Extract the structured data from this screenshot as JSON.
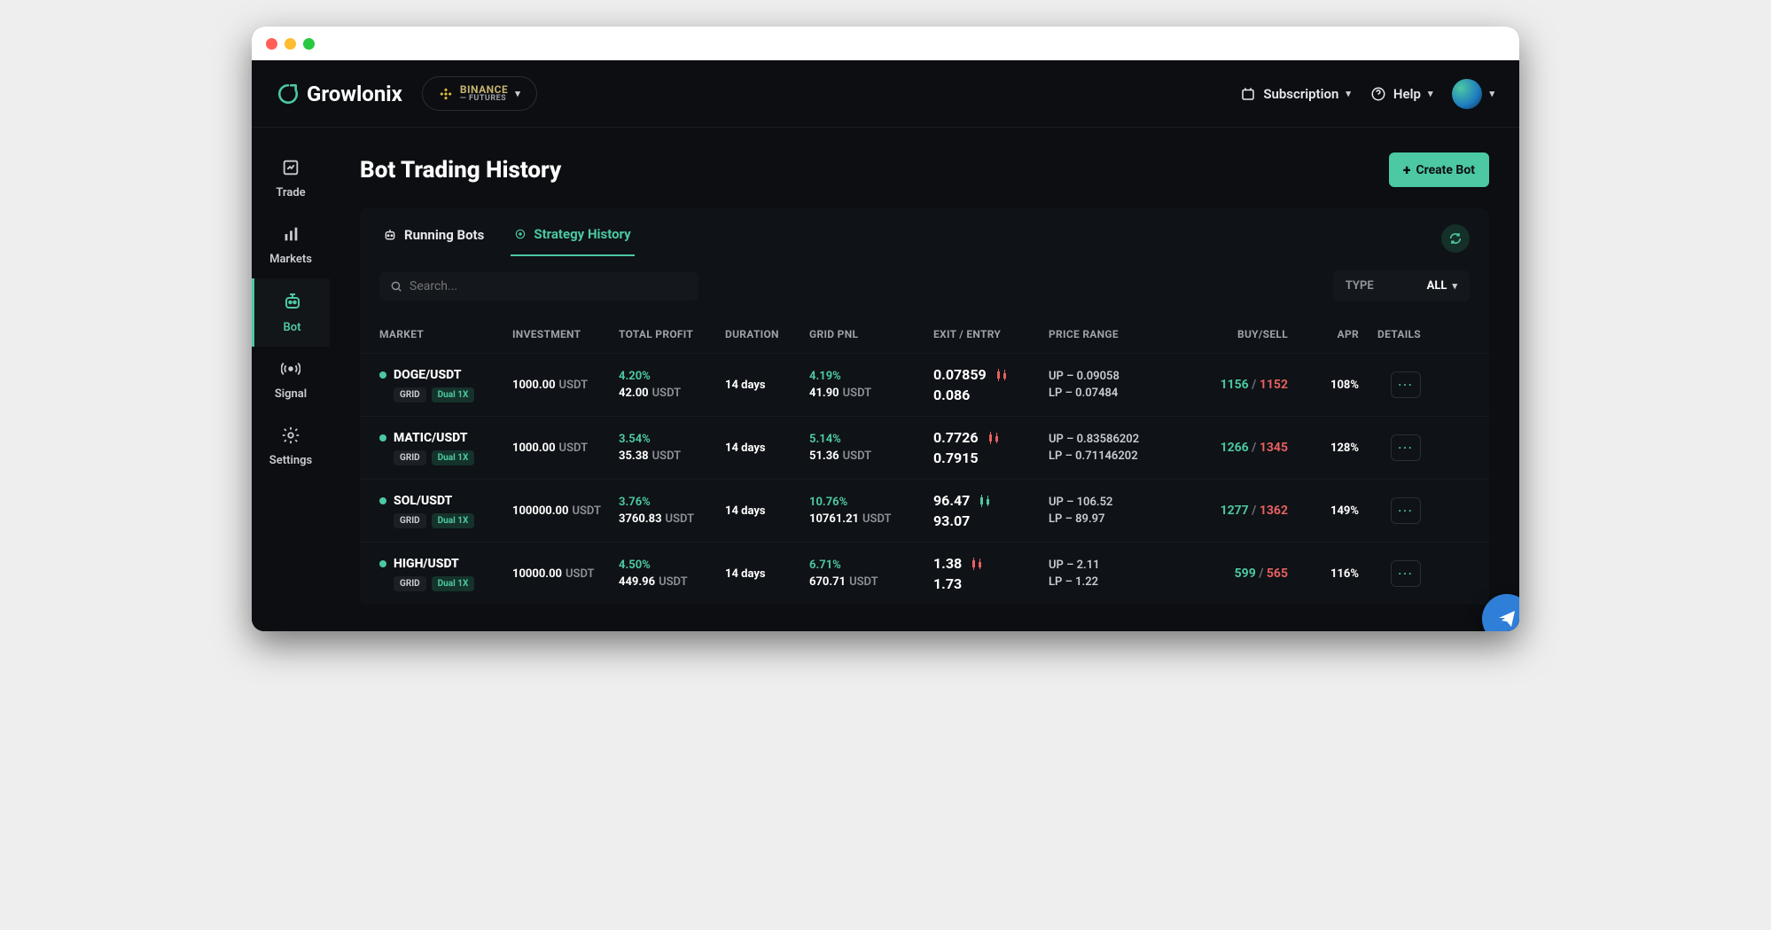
{
  "brand": "Growlonix",
  "exchange": {
    "name": "BINANCE",
    "sub": "— FUTURES"
  },
  "topbar": {
    "subscription": "Subscription",
    "help": "Help"
  },
  "sidebar": [
    {
      "id": "trade",
      "label": "Trade"
    },
    {
      "id": "markets",
      "label": "Markets"
    },
    {
      "id": "bot",
      "label": "Bot",
      "active": true
    },
    {
      "id": "signal",
      "label": "Signal"
    },
    {
      "id": "settings",
      "label": "Settings"
    }
  ],
  "page": {
    "title": "Bot Trading History",
    "create_btn": "Create Bot"
  },
  "tabs": {
    "running": "Running Bots",
    "history": "Strategy History"
  },
  "search": {
    "placeholder": "Search..."
  },
  "type_filter": {
    "label": "TYPE",
    "value": "ALL"
  },
  "columns": {
    "market": "MARKET",
    "investment": "INVESTMENT",
    "total_profit": "TOTAL PROFIT",
    "duration": "DURATION",
    "grid_pnl": "GRID PNL",
    "exit_entry": "EXIT / ENTRY",
    "price_range": "PRICE RANGE",
    "buy_sell": "BUY/SELL",
    "apr": "APR",
    "details": "DETAILS"
  },
  "badges": {
    "grid": "GRID",
    "dual": "Dual 1X"
  },
  "rows": [
    {
      "market": "DOGE/USDT",
      "invest_amount": "1000.00",
      "invest_unit": "USDT",
      "tp_pct": "4.20%",
      "tp_amount": "42.00",
      "tp_unit": "USDT",
      "duration": "14 days",
      "pnl_pct": "4.19%",
      "pnl_amount": "41.90",
      "pnl_unit": "USDT",
      "exit": "0.07859",
      "entry": "0.086",
      "candle": "red",
      "up": "UP – 0.09058",
      "lp": "LP – 0.07484",
      "buy": "1156",
      "sell": "1152",
      "apr": "108%"
    },
    {
      "market": "MATIC/USDT",
      "invest_amount": "1000.00",
      "invest_unit": "USDT",
      "tp_pct": "3.54%",
      "tp_amount": "35.38",
      "tp_unit": "USDT",
      "duration": "14 days",
      "pnl_pct": "5.14%",
      "pnl_amount": "51.36",
      "pnl_unit": "USDT",
      "exit": "0.7726",
      "entry": "0.7915",
      "candle": "red",
      "up": "UP – 0.83586202",
      "lp": "LP – 0.71146202",
      "buy": "1266",
      "sell": "1345",
      "apr": "128%"
    },
    {
      "market": "SOL/USDT",
      "invest_amount": "100000.00",
      "invest_unit": "USDT",
      "tp_pct": "3.76%",
      "tp_amount": "3760.83",
      "tp_unit": "USDT",
      "duration": "14 days",
      "pnl_pct": "10.76%",
      "pnl_amount": "10761.21",
      "pnl_unit": "USDT",
      "exit": "96.47",
      "entry": "93.07",
      "candle": "green",
      "up": "UP – 106.52",
      "lp": "LP – 89.97",
      "buy": "1277",
      "sell": "1362",
      "apr": "149%"
    },
    {
      "market": "HIGH/USDT",
      "invest_amount": "10000.00",
      "invest_unit": "USDT",
      "tp_pct": "4.50%",
      "tp_amount": "449.96",
      "tp_unit": "USDT",
      "duration": "14 days",
      "pnl_pct": "6.71%",
      "pnl_amount": "670.71",
      "pnl_unit": "USDT",
      "exit": "1.38",
      "entry": "1.73",
      "candle": "red",
      "up": "UP – 2.11",
      "lp": "LP – 1.22",
      "buy": "599",
      "sell": "565",
      "apr": "116%"
    }
  ]
}
